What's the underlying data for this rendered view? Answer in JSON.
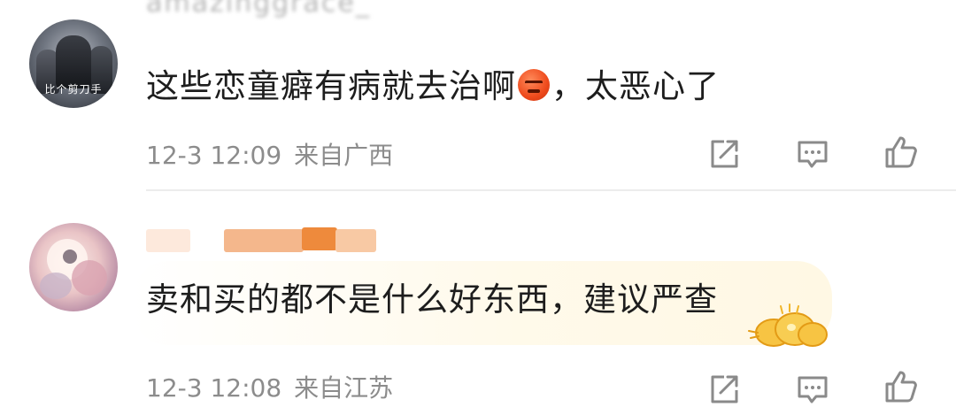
{
  "comments": [
    {
      "username": "amazinggrace_",
      "avatar_caption": "比个剪刀手",
      "text_before_emoji": "这些恋童癖有病就去治啊",
      "emoji": "angry-face-emoji",
      "text_after_emoji": "，太恶心了",
      "time": "12-3 12:09",
      "location": "来自广西"
    },
    {
      "username": "",
      "text": "卖和买的都不是什么好东西，建议严查",
      "sticker": "gold-clouds-sticker",
      "time": "12-3 12:08",
      "location": "来自江苏"
    }
  ],
  "icons": {
    "share": "share-icon",
    "comment": "comment-icon",
    "like": "like-icon"
  },
  "colors": {
    "meta_text": "#8c8c8c",
    "emoji_red": "#ee4a1c",
    "sticker_gold": "#f6c542"
  }
}
